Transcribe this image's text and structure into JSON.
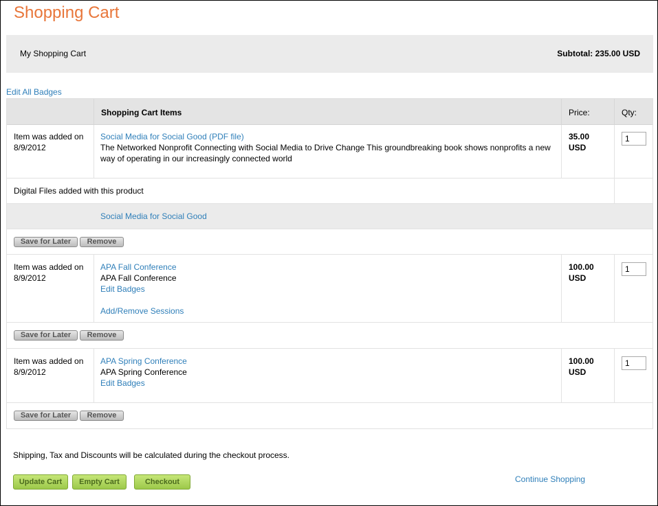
{
  "page": {
    "title": "Shopping Cart"
  },
  "summary": {
    "label": "My Shopping Cart",
    "subtotal": "Subtotal: 235.00 USD"
  },
  "edit_all_badges": "Edit All Badges",
  "table": {
    "headers": {
      "blank": "",
      "items": "Shopping Cart Items",
      "price": "Price:",
      "qty": "Qty:"
    }
  },
  "items": [
    {
      "added_line1": "Item was added on",
      "added_line2": "8/9/2012",
      "title": "Social Media for Social Good (PDF file)",
      "description": "The Networked Nonprofit Connecting with Social Media to Drive Change This groundbreaking book shows nonprofits a new way of operating in our increasingly connected world",
      "price_amount": "35.00",
      "price_currency": "USD",
      "qty": "1",
      "digital_files_label": "Digital Files added with this product",
      "digital_file_link": "Social Media for Social Good"
    },
    {
      "added_line1": "Item was added on",
      "added_line2": "8/9/2012",
      "title": "APA Fall Conference",
      "subtitle": "APA Fall Conference",
      "edit_badges": "Edit Badges",
      "sessions_link": "Add/Remove Sessions",
      "price_amount": "100.00",
      "price_currency": "USD",
      "qty": "1"
    },
    {
      "added_line1": "Item was added on",
      "added_line2": "8/9/2012",
      "title": "APA Spring Conference",
      "subtitle": "APA Spring Conference",
      "edit_badges": "Edit Badges",
      "price_amount": "100.00",
      "price_currency": "USD",
      "qty": "1"
    }
  ],
  "row_actions": {
    "save_for_later": "Save for Later",
    "remove": "Remove"
  },
  "footer": {
    "note": "Shipping, Tax and Discounts will be calculated during the checkout process.",
    "update_cart": "Update Cart",
    "empty_cart": "Empty Cart",
    "checkout": "Checkout",
    "continue_shopping": "Continue Shopping"
  },
  "colors": {
    "title": "#e8763a",
    "link": "#2f7fb9",
    "summary_bg": "#ebebeb",
    "green_button": "#9cc94a"
  }
}
